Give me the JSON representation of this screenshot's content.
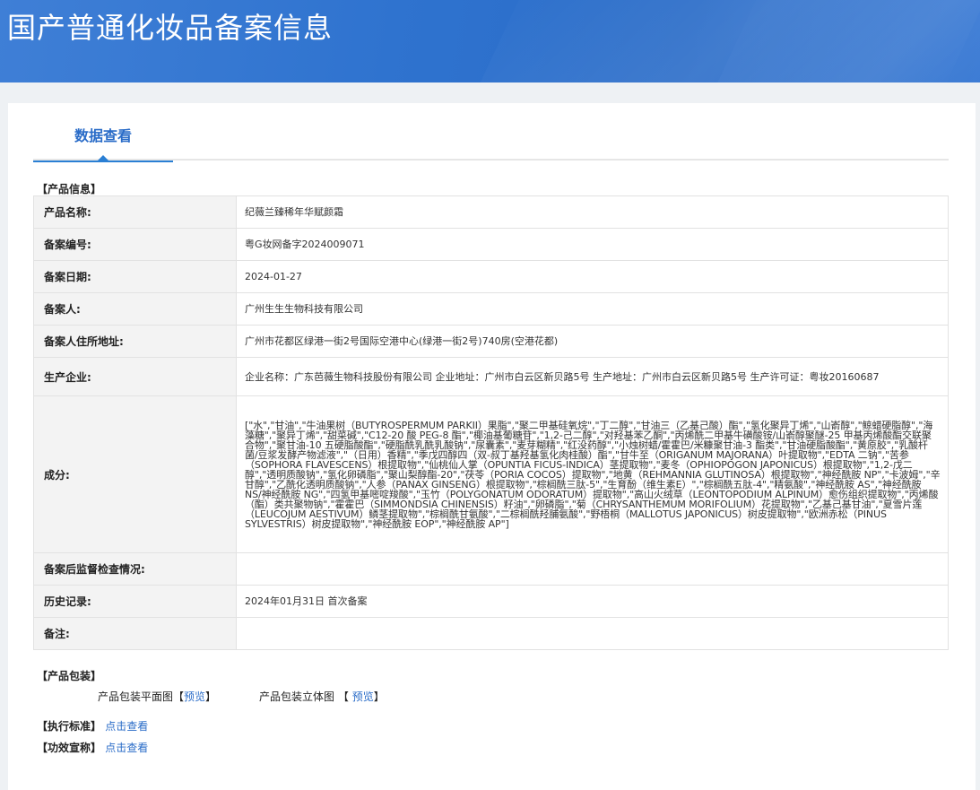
{
  "header": {
    "title": "国产普通化妆品备案信息"
  },
  "tabs": [
    {
      "label": "数据查看",
      "active": true
    }
  ],
  "sections": {
    "product_info": "【产品信息】",
    "packaging": "【产品包装】",
    "standard": "【执行标准】",
    "efficacy": "【功效宣称】"
  },
  "product_info": {
    "rows": [
      {
        "label": "产品名称:",
        "value": "纪薇兰臻稀年华赋颜霜"
      },
      {
        "label": "备案编号:",
        "value": "粤G妆网备字2024009071"
      },
      {
        "label": "备案日期:",
        "value": "2024-01-27"
      },
      {
        "label": "备案人:",
        "value": "广州生生生物科技有限公司"
      },
      {
        "label": "备案人住所地址:",
        "value": "广州市花都区绿港一街2号国际空港中心(绿港一街2号)740房(空港花都)"
      },
      {
        "label": "生产企业:",
        "value": "企业名称：广东芭薇生物科技股份有限公司 企业地址：广州市白云区新贝路5号 生产地址：广州市白云区新贝路5号 生产许可证：粤妆20160687"
      },
      {
        "label": "成分:",
        "value": "[\"水\",\"甘油\",\"牛油果树（BUTYROSPERMUM PARKII）果脂\",\"聚二甲基硅氧烷\",\"丁二醇\",\"甘油三（乙基己酸）酯\",\"氢化聚异丁烯\",\"山嵛醇\",\"鲸蜡硬脂醇\",\"海藻糖\",\"聚异丁烯\",\"甜菜碱\",\"C12-20 酸 PEG-8 酯\",\"椰油基葡糖苷\",\"1,2-己二醇\",\"对羟基苯乙酮\",\"丙烯酰二甲基牛磺酸铵/山嵛醇聚醚-25 甲基丙烯酸酯交联聚合物\",\"聚甘油-10 五硬脂酸酯\",\"硬脂酰乳酰乳酸钠\",\"尿囊素\",\"麦芽糊精\",\"红没药醇\",\"小烛树蜡/霍霍巴/米糠聚甘油-3 酯类\",\"甘油硬脂酸酯\",\"黄原胶\",\"乳酸杆菌/豆浆发酵产物滤液\",\"（日用）香精\",\"季戊四醇四（双-叔丁基羟基氢化肉桂酸）酯\",\"甘牛至（ORIGANUM MAJORANA）叶提取物\",\"EDTA 二钠\",\"苦参（SOPHORA FLAVESCENS）根提取物\",\"仙桃仙人掌（OPUNTIA FICUS-INDICA）茎提取物\",\"麦冬（OPHIOPOGON JAPONICUS）根提取物\",\"1,2-戊二醇\",\"透明质酸钠\",\"氢化卵磷脂\",\"聚山梨醇酯-20\",\"茯苓（PORIA COCOS）提取物\",\"地黄（REHMANNIA GLUTINOSA）根提取物\",\"神经酰胺 NP\",\"卡波姆\",\"辛甘醇\",\"乙酰化透明质酸钠\",\"人参（PANAX GINSENG）根提取物\",\"棕榈酰三肽-5\",\"生育酚（维生素E）\",\"棕榈酰五肽-4\",\"精氨酸\",\"神经酰胺 AS\",\"神经酰胺 NS/神经酰胺 NG\",\"四氢甲基嘧啶羧酸\",\"玉竹（POLYGONATUM ODORATUM）提取物\",\"高山火绒草（LEONTOPODIUM ALPINUM）愈伤组织提取物\",\"丙烯酸（酯）类共聚物钠\",\"霍霍巴（SIMMONDSIA CHINENSIS）籽油\",\"卵磷脂\",\"菊（CHRYSANTHEMUM MORIFOLIUM）花提取物\",\"乙基己基甘油\",\"夏雪片莲（LEUCOJUM AESTIVUM）鳞茎提取物\",\"棕榈酰甘氨酸\",\"二棕榈酰羟脯氨酸\",\"野梧桐（MALLOTUS JAPONICUS）树皮提取物\",\"欧洲赤松（PINUS SYLVESTRIS）树皮提取物\",\"神经酰胺 EOP\",\"神经酰胺 AP\"]"
      },
      {
        "label": "备案后监督检查情况:",
        "value": ""
      },
      {
        "label": "历史记录:",
        "value": "2024年01月31日 首次备案"
      },
      {
        "label": "备注:",
        "value": ""
      }
    ]
  },
  "packaging": {
    "flat_label": "产品包装平面图",
    "flat_link": "预览",
    "solid_label": "产品包装立体图",
    "solid_link": "预览",
    "bracket_open": "【",
    "bracket_close": "】"
  },
  "links": {
    "standard_link": "点击查看",
    "efficacy_link": "点击查看"
  },
  "colors": {
    "accent": "#2a6cc8",
    "banner": "#2f73cf",
    "table_border": "#4a8fd8"
  }
}
